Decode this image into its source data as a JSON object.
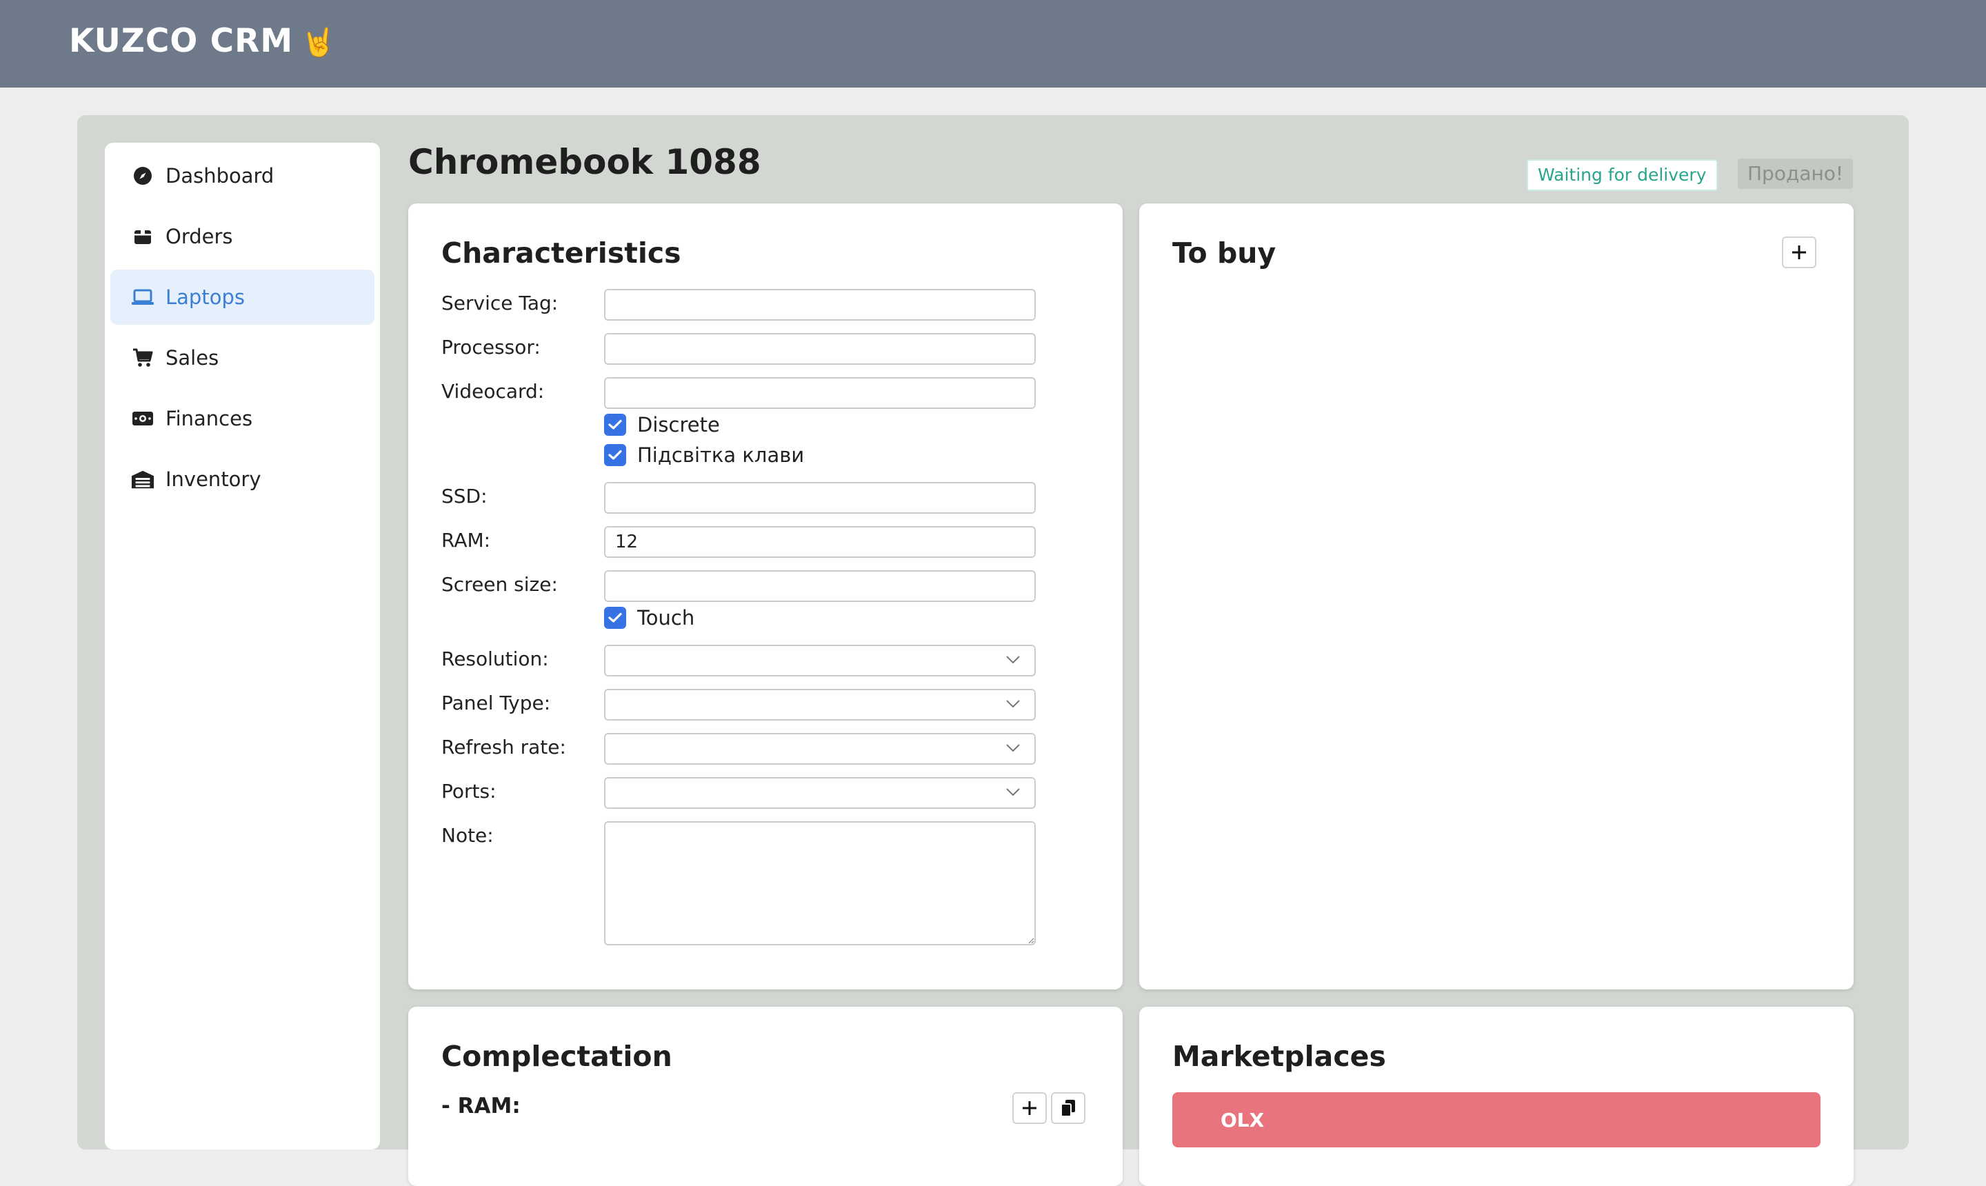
{
  "app": {
    "brand": "KUZCO CRM",
    "brand_emoji": "🤘"
  },
  "sidebar": {
    "items": [
      {
        "label": "Dashboard",
        "icon": "compass-icon"
      },
      {
        "label": "Orders",
        "icon": "box-icon"
      },
      {
        "label": "Laptops",
        "icon": "laptop-icon",
        "active": true
      },
      {
        "label": "Sales",
        "icon": "cart-icon"
      },
      {
        "label": "Finances",
        "icon": "money-icon"
      },
      {
        "label": "Inventory",
        "icon": "warehouse-icon"
      }
    ]
  },
  "page": {
    "title": "Chromebook 1088",
    "status_badge": "Waiting for delivery",
    "sold_button": "Продано!"
  },
  "characteristics": {
    "title": "Characteristics",
    "service_tag_label": "Service Tag:",
    "service_tag_value": "",
    "processor_label": "Processor:",
    "processor_value": "",
    "videocard_label": "Videocard:",
    "videocard_value": "",
    "discrete_label": "Discrete",
    "discrete_checked": true,
    "backlight_label": "Підсвітка клави",
    "backlight_checked": true,
    "ssd_label": "SSD:",
    "ssd_value": "",
    "ram_label": "RAM:",
    "ram_value": "12",
    "screen_size_label": "Screen size:",
    "screen_size_value": "",
    "touch_label": "Touch",
    "touch_checked": true,
    "resolution_label": "Resolution:",
    "resolution_value": "",
    "panel_type_label": "Panel Type:",
    "panel_type_value": "",
    "refresh_rate_label": "Refresh rate:",
    "refresh_rate_value": "",
    "ports_label": "Ports:",
    "ports_value": "",
    "note_label": "Note:",
    "note_value": ""
  },
  "to_buy": {
    "title": "To buy"
  },
  "complectation": {
    "title": "Complectation",
    "ram_label": "- RAM:"
  },
  "marketplaces": {
    "title": "Marketplaces",
    "first_label": "OLX"
  },
  "colors": {
    "topbar": "#6e7a89",
    "shell": "#d2d7d2",
    "accent": "#3b7fd4",
    "checkbox": "#3672e3",
    "marketplace_bar": "#e8747e"
  }
}
